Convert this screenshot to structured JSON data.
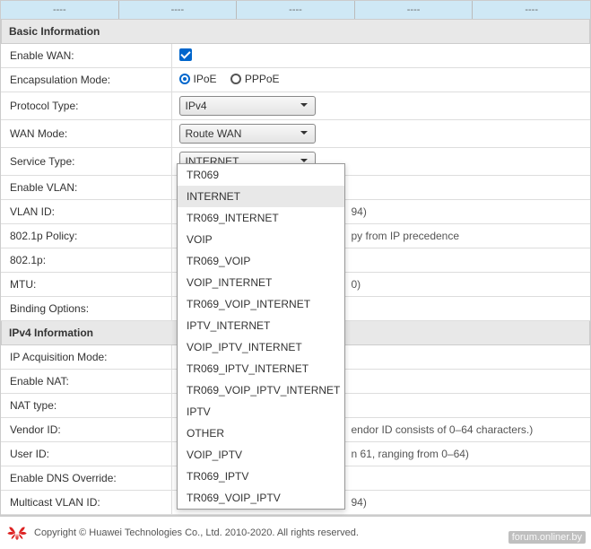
{
  "tabs": [
    "----",
    "----",
    "----",
    "----",
    "----"
  ],
  "sections": {
    "basic": "Basic Information",
    "ipv4": "IPv4 Information"
  },
  "rows": {
    "enable_wan": "Enable WAN:",
    "encap": "Encapsulation Mode:",
    "protocol": "Protocol Type:",
    "wan_mode": "WAN Mode:",
    "service_type": "Service Type:",
    "enable_vlan": "Enable VLAN:",
    "vlan_id": "VLAN ID:",
    "policy": "802.1p Policy:",
    "policy_hint": "py from IP precedence",
    "p8021": "802.1p:",
    "mtu": "MTU:",
    "binding": "Binding Options:",
    "ip_acq": "IP Acquisition Mode:",
    "enable_nat": "Enable NAT:",
    "nat_type": "NAT type:",
    "vendor": "Vendor ID:",
    "vendor_hint": "endor ID consists of 0–64 characters.)",
    "user_id": "User ID:",
    "user_hint": "n 61, ranging from 0–64)",
    "dns": "Enable DNS Override:",
    "mvlan": "Multicast VLAN ID:",
    "vlan_hint": "94)",
    "mtu_hint": "0)",
    "mvlan_hint": "94)"
  },
  "values": {
    "ipoe": "IPoE",
    "pppoe": "PPPoE",
    "protocol_sel": "IPv4",
    "wan_sel": "Route WAN",
    "service_sel": "INTERNET"
  },
  "dropdown_options": [
    "TR069",
    "INTERNET",
    "TR069_INTERNET",
    "VOIP",
    "TR069_VOIP",
    "VOIP_INTERNET",
    "TR069_VOIP_INTERNET",
    "IPTV_INTERNET",
    "VOIP_IPTV_INTERNET",
    "TR069_IPTV_INTERNET",
    "TR069_VOIP_IPTV_INTERNET",
    "IPTV",
    "OTHER",
    "VOIP_IPTV",
    "TR069_IPTV",
    "TR069_VOIP_IPTV"
  ],
  "dropdown_highlight": "INTERNET",
  "footer": "Copyright © Huawei Technologies Co., Ltd. 2010-2020. All rights reserved.",
  "watermark": "forum.onliner.by"
}
